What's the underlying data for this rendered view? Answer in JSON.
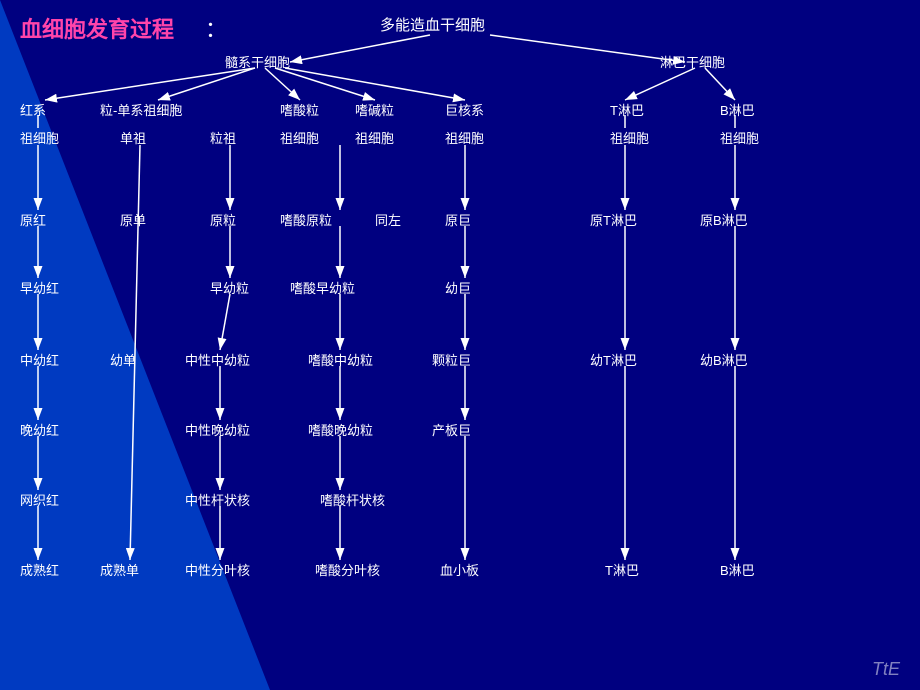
{
  "title": "血细胞发育过程",
  "colon": "：",
  "multipotent": "多能造血干细胞",
  "nodes": {
    "marrow_stem": "髓系干细胞",
    "lymph_stem": "淋巴干细胞",
    "red_series": "红系",
    "gran_mono": "粒-单系祖细胞",
    "eosin_gran": "嗜酸粒",
    "baso_gran": "嗜碱粒",
    "mega_series": "巨核系",
    "t_lymph": "T淋巴",
    "b_lymph": "B淋巴",
    "progenitor_red": "祖细胞",
    "progenitor_mono": "单祖",
    "progenitor_gran": "粒祖",
    "progenitor_eosin": "祖细胞",
    "progenitor_baso": "祖细胞",
    "progenitor_mega": "祖细胞",
    "progenitor_t": "祖细胞",
    "progenitor_b": "祖细胞",
    "proto_red": "原红",
    "proto_mono": "原单",
    "proto_gran": "原粒",
    "proto_eosin": "嗜酸原粒",
    "same_left": "同左",
    "proto_mega": "原巨",
    "proto_t": "原T淋巴",
    "proto_b": "原B淋巴",
    "early_red": "早幼红",
    "early_gran": "早幼粒",
    "early_eosin": "嗜酸早幼粒",
    "young_mega": "幼巨",
    "mid_red": "中幼红",
    "young_mono": "幼单",
    "mid_neut_gran": "中性中幼粒",
    "mid_eosin_gran": "嗜酸中幼粒",
    "gran_mega": "颗粒巨",
    "young_t": "幼T淋巴",
    "young_b": "幼B淋巴",
    "late_red": "晚幼红",
    "late_neut_gran": "中性晚幼粒",
    "late_eosin_gran": "嗜酸晚幼粒",
    "platelet_mega": "产板巨",
    "retic_red": "网织红",
    "band_neut": "中性杆状核",
    "band_eosin": "嗜酸杆状核",
    "mature_red": "成熟红",
    "mature_mono": "成熟单",
    "seg_neut": "中性分叶核",
    "seg_eosin": "嗜酸分叶核",
    "platelet": "血小板",
    "t_cell": "T淋巴",
    "b_cell": "B淋巴"
  },
  "watermark": "TtE"
}
